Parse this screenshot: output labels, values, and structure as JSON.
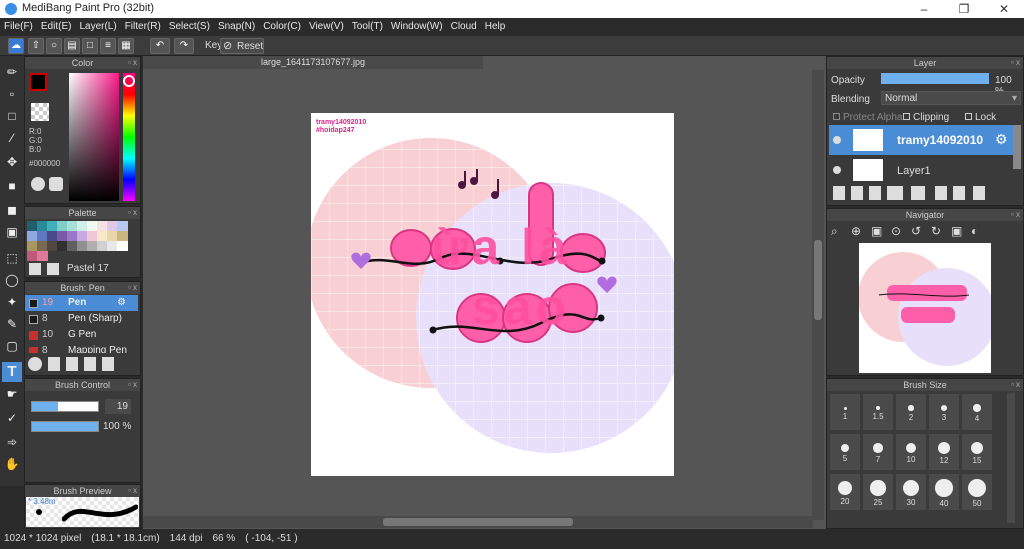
{
  "app": {
    "title": "MediBang Paint Pro (32bit)"
  },
  "menu": [
    "File(F)",
    "Edit(E)",
    "Layer(L)",
    "Filter(R)",
    "Select(S)",
    "Snap(N)",
    "Color(C)",
    "View(V)",
    "Tool(T)",
    "Window(W)",
    "Cloud",
    "Help"
  ],
  "toolbar": {
    "key_label": "Key",
    "reset_label": "Reset"
  },
  "document": {
    "tab_title": "large_1641173107677.jpg"
  },
  "color_panel": {
    "title": "Color",
    "r": "R:0",
    "g": "G:0",
    "b": "B:0",
    "hex": "#000000"
  },
  "palette_panel": {
    "title": "Palette",
    "palette_name": "Pastel 17"
  },
  "brush_panel": {
    "title": "Brush: Pen",
    "items": [
      {
        "size": "19",
        "name": "Pen",
        "color": "#1a1a1a",
        "selected": true
      },
      {
        "size": "8",
        "name": "Pen (Sharp)",
        "color": "#1a1a1a",
        "selected": false
      },
      {
        "size": "10",
        "name": "G Pen",
        "color": "#c83030",
        "selected": false
      },
      {
        "size": "8",
        "name": "Mapping Pen",
        "color": "#c83030",
        "selected": false
      }
    ]
  },
  "brush_control": {
    "title": "Brush Control",
    "size_value": "19",
    "opacity_value": "100 %"
  },
  "brush_preview": {
    "title": "Brush Preview",
    "size_text": "* 3.48m"
  },
  "layer_panel": {
    "title": "Layer",
    "opacity_label": "Opacity",
    "opacity_value": "100 %",
    "blending_label": "Blending",
    "blending_value": "Normal",
    "protect_alpha": "Protect Alpha",
    "clipping": "Clipping",
    "lock": "Lock",
    "layers": [
      {
        "name": "tramy14092010",
        "selected": true
      },
      {
        "name": "Layer1",
        "selected": false
      }
    ]
  },
  "navigator_panel": {
    "title": "Navigator"
  },
  "brush_size_panel": {
    "title": "Brush Size",
    "sizes": [
      "1",
      "1.5",
      "2",
      "3",
      "4",
      "5",
      "7",
      "10",
      "12",
      "15",
      "20",
      "25",
      "30",
      "40",
      "50"
    ]
  },
  "artwork": {
    "credit_line1": "tramy14092010",
    "credit_line2": "#hoidap247",
    "text_line1": "ừa là",
    "text_line2": "sao"
  },
  "status": {
    "pixel_size": "1024 * 1024 pixel",
    "cm_size": "(18.1 * 18.1cm)",
    "dpi": "144 dpi",
    "zoom": "66 %",
    "coords": "( -104, -51 )"
  }
}
